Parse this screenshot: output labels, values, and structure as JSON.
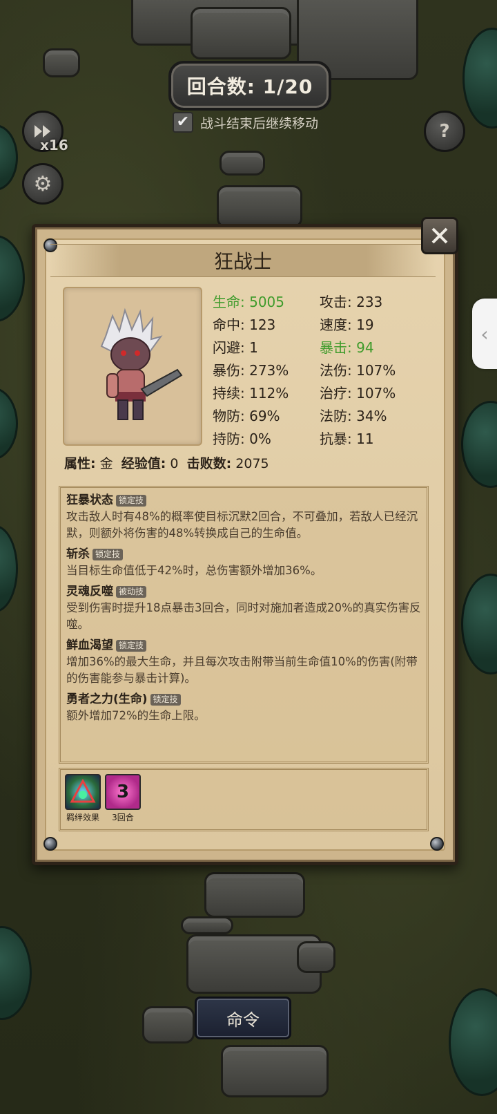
{
  "hud": {
    "round_label": "回合数: 1/20",
    "continue_label": "战斗结束后继续移动",
    "continue_checked": "✔",
    "speed_label": "x16",
    "help_label": "?",
    "side_tab_arrow": "‹",
    "icons": {
      "speed": "fast-forward-icon",
      "settings": "gear-icon",
      "help": "question-icon",
      "close": "crossed-swords-close-icon"
    }
  },
  "hero": {
    "name": "狂战士",
    "stats": [
      {
        "left": "生命: 5005",
        "right": "攻击: 233"
      },
      {
        "left": "命中: 123",
        "right": "速度: 19"
      },
      {
        "left": "闪避: 1",
        "right": "暴击: 94"
      },
      {
        "left": "暴伤: 273%",
        "right": "法伤: 107%"
      },
      {
        "left": "持续: 112%",
        "right": "治疗: 107%"
      },
      {
        "left": "物防: 69%",
        "right": "法防: 34%"
      },
      {
        "left": "持防: 0%",
        "right": "抗暴: 11"
      }
    ],
    "attr_label": "属性:",
    "attr_value": "金",
    "exp_label": "经验值:",
    "exp_value": "0",
    "kills_label": "击败数:",
    "kills_value": "2075"
  },
  "skills": [
    {
      "name": "狂暴状态",
      "tag": "锁定技",
      "desc": "攻击敌人时有48%的概率使目标沉默2回合，不可叠加，若敌人已经沉默，则额外将伤害的48%转换成自己的生命值。"
    },
    {
      "name": "斩杀",
      "tag": "锁定技",
      "desc": "当目标生命值低于42%时，总伤害额外增加36%。"
    },
    {
      "name": "灵魂反噬",
      "tag": "被动技",
      "desc": "受到伤害时提升18点暴击3回合，同时对施加者造成20%的真实伤害反噬。"
    },
    {
      "name": "鲜血渴望",
      "tag": "锁定技",
      "desc": "增加36%的最大生命，并且每次攻击附带当前生命值10%的伤害(附带的伤害能参与暴击计算)。"
    },
    {
      "name": "勇者之力(生命)",
      "tag": "锁定技",
      "desc": "额外增加72%的生命上限。"
    }
  ],
  "buffs": [
    {
      "label": "羁绊效果",
      "icon": "bond-effect-icon"
    },
    {
      "label": "3回合",
      "icon": "three-rounds-icon",
      "number": "3"
    }
  ],
  "command_label": "命令",
  "colors": {
    "highlight_green": "#3e9b2b",
    "panel": "#e6d3ae",
    "text": "#2b2219"
  }
}
